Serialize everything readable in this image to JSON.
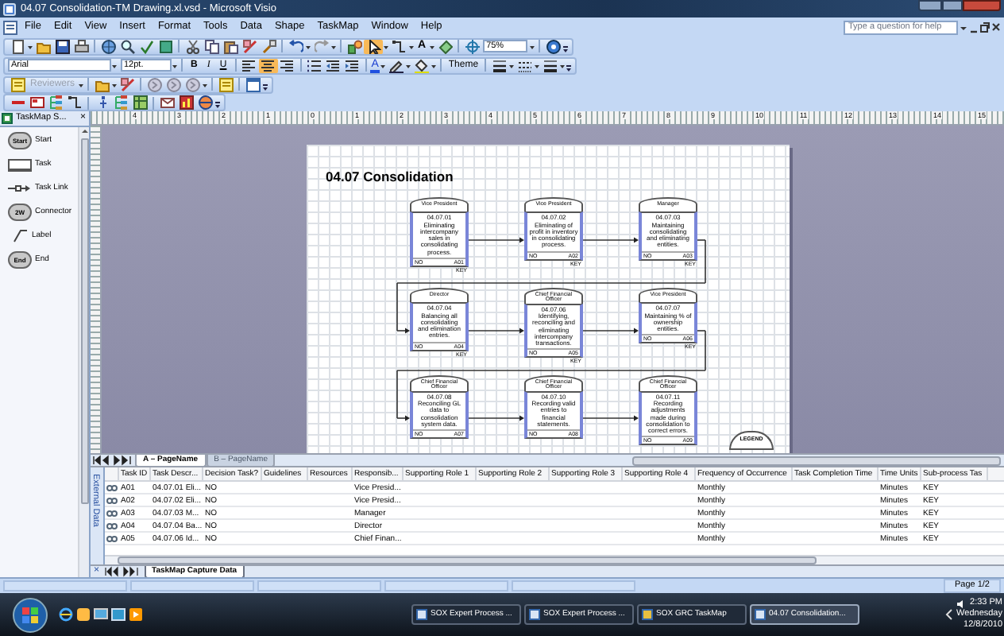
{
  "window": {
    "title": "04.07 Consolidation-TM Drawing.xl.vsd - Microsoft Visio"
  },
  "menu": [
    "File",
    "Edit",
    "View",
    "Insert",
    "Format",
    "Tools",
    "Data",
    "Shape",
    "TaskMap",
    "Window",
    "Help"
  ],
  "help": {
    "placeholder": "Type a question for help"
  },
  "toolbar": {
    "text_tool": "A",
    "zoom": "75%",
    "font": "Arial",
    "size": "12pt.",
    "bold": "B",
    "italic": "I",
    "underline": "U",
    "font_color": "A",
    "theme": "Theme",
    "reviewers": "Reviewers"
  },
  "stencil": {
    "title": "TaskMap S...",
    "close": "×",
    "items": [
      {
        "kind": "start",
        "label": "Start",
        "badge": "Start"
      },
      {
        "kind": "task",
        "label": "Task"
      },
      {
        "kind": "link",
        "label": "Task Link"
      },
      {
        "kind": "connector",
        "label": "Connector",
        "badge": "2W"
      },
      {
        "kind": "label",
        "label": "Label"
      },
      {
        "kind": "end",
        "label": "End",
        "badge": "End"
      }
    ]
  },
  "ruler": [
    "4",
    "3",
    "2",
    "1",
    "0",
    "1",
    "2",
    "3",
    "4",
    "5",
    "6",
    "7",
    "8",
    "9",
    "10",
    "11",
    "12",
    "13",
    "14",
    "15"
  ],
  "diagram": {
    "title": "04.07 Consolidation",
    "legend": "LEGEND",
    "shapes": [
      {
        "role": "Vice President",
        "number": "04.07.01",
        "description": "Eliminating intercompany sales in consolidating process.",
        "decision": "NO",
        "code": "A01",
        "key": "KEY"
      },
      {
        "role": "Vice President",
        "number": "04.07.02",
        "description": "Eliminating of profit in inventory in consolidating process.",
        "decision": "NO",
        "code": "A02",
        "key": "KEY"
      },
      {
        "role": "Manager",
        "number": "04.07.03",
        "description": "Maintaining consolidating and eliminating entities.",
        "decision": "NO",
        "code": "A03",
        "key": "KEY"
      },
      {
        "role": "Director",
        "number": "04.07.04",
        "description": "Balancing all consolidating and elimination entries.",
        "decision": "NO",
        "code": "A04",
        "key": "KEY"
      },
      {
        "role": "Chief Financial Officer",
        "number": "04.07.06",
        "description": "Identifying, reconciling and eliminating intercompany transactions.",
        "decision": "NO",
        "code": "A05",
        "key": "KEY"
      },
      {
        "role": "Vice President",
        "number": "04.07.07",
        "description": "Maintaining % of ownership entities.",
        "decision": "NO",
        "code": "A06",
        "key": "KEY"
      },
      {
        "role": "Chief Financial Officer",
        "number": "04.07.08",
        "description": "Reconciling GL data to consolidation system data.",
        "decision": "NO",
        "code": "A07"
      },
      {
        "role": "Chief Financial Officer",
        "number": "04.07.10",
        "description": "Recording valid entries to financial statements.",
        "decision": "NO",
        "code": "A08"
      },
      {
        "role": "Chief Financial Officer",
        "number": "04.07.11",
        "description": "Recording adjustments made during consolidation to correct errors.",
        "decision": "NO",
        "code": "A09"
      }
    ]
  },
  "page_tabs": [
    {
      "label": "A – PageName",
      "selected": true
    },
    {
      "label": "B – PageName",
      "selected": false
    }
  ],
  "external_data": {
    "label": "External Data",
    "columns": [
      "Task ID",
      "Task Descr...",
      "Decision Task?",
      "Guidelines",
      "Resources",
      "Responsib...",
      "Supporting Role 1",
      "Supporting Role 2",
      "Supporting Role 3",
      "Supporting Role 4",
      "Frequency of Occurrence",
      "Task Completion Time",
      "Time Units",
      "Sub-process Tas"
    ],
    "rows": [
      [
        "A01",
        "04.07.01 Eli...",
        "NO",
        null,
        null,
        "Vice Presid...",
        null,
        null,
        null,
        null,
        "Monthly",
        null,
        "Minutes",
        "KEY"
      ],
      [
        "A02",
        "04.07.02 Eli...",
        "NO",
        null,
        null,
        "Vice Presid...",
        null,
        null,
        null,
        null,
        "Monthly",
        null,
        "Minutes",
        "KEY"
      ],
      [
        "A03",
        "04.07.03 M...",
        "NO",
        null,
        null,
        "Manager",
        null,
        null,
        null,
        null,
        "Monthly",
        null,
        "Minutes",
        "KEY"
      ],
      [
        "A04",
        "04.07.04 Ba...",
        "NO",
        null,
        null,
        "Director",
        null,
        null,
        null,
        null,
        "Monthly",
        null,
        "Minutes",
        "KEY"
      ],
      [
        "A05",
        "04.07.06 Id...",
        "NO",
        null,
        null,
        "Chief Finan...",
        null,
        null,
        null,
        null,
        "Monthly",
        null,
        "Minutes",
        "KEY"
      ]
    ],
    "close": "×",
    "tabs": [
      {
        "label": "TaskMap Capture Data",
        "selected": true
      }
    ]
  },
  "status_bar": {
    "page": "Page 1/2"
  },
  "taskbar": {
    "tasks": [
      {
        "label": "SOX Expert Process ...",
        "selected": false
      },
      {
        "label": "SOX Expert Process ...",
        "selected": false
      },
      {
        "label": "SOX GRC TaskMap",
        "selected": false
      },
      {
        "label": "04.07 Consolidation...",
        "selected": true
      }
    ],
    "clock": {
      "time": "2:33 PM",
      "day": "Wednesday",
      "date": "12/8/2010"
    }
  }
}
